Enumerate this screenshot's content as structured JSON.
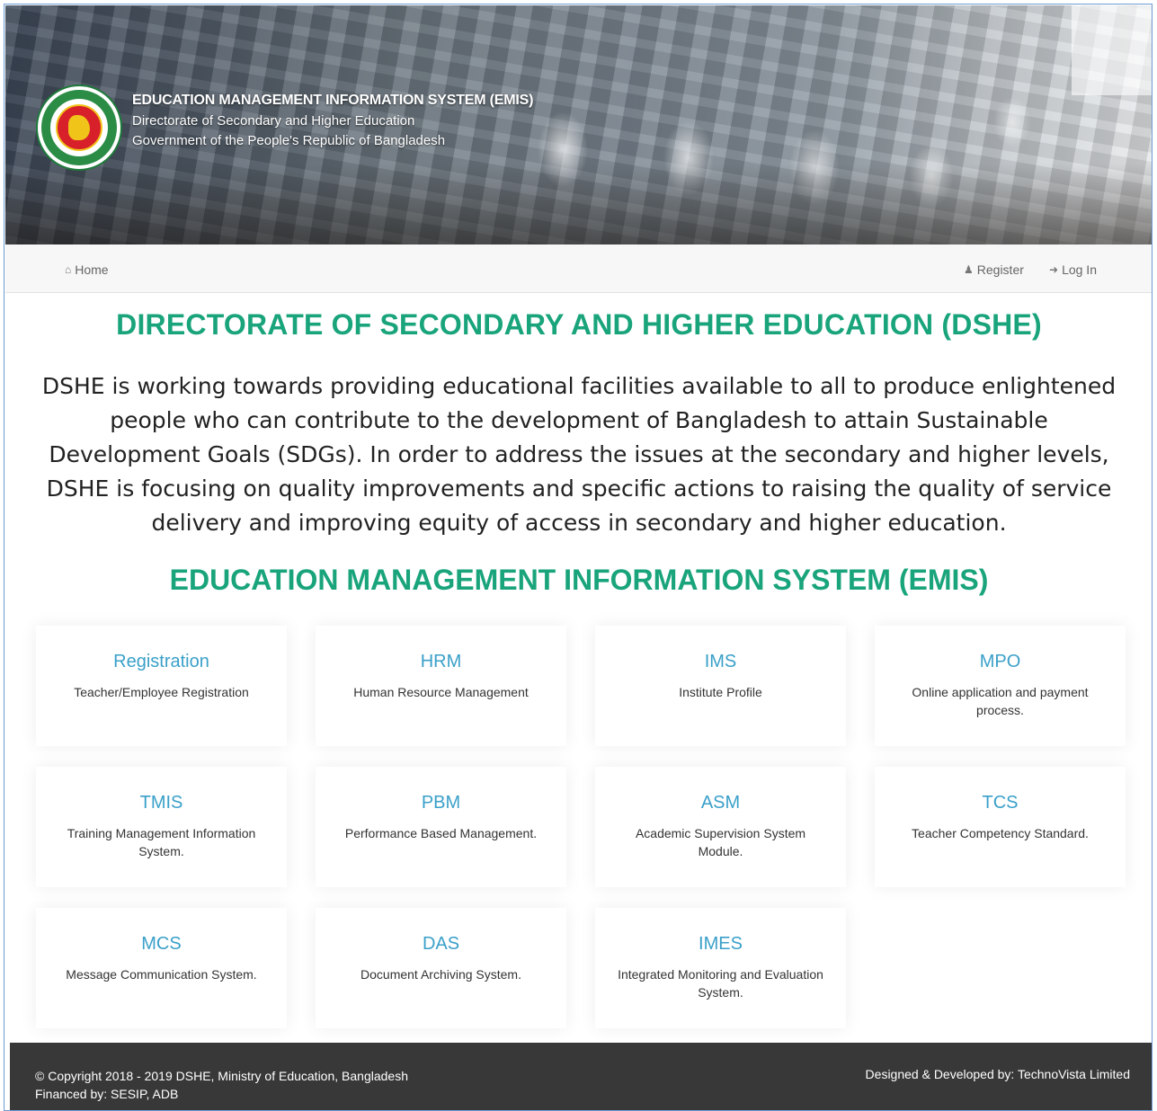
{
  "header": {
    "title": "EDUCATION MANAGEMENT INFORMATION SYSTEM (EMIS)",
    "subtitle1": "Directorate of Secondary and Higher Education",
    "subtitle2": "Government of the People's Republic of Bangladesh"
  },
  "nav": {
    "home": "Home",
    "register": "Register",
    "login": "Log In",
    "icons": {
      "home": "home-icon",
      "register": "user-icon",
      "login": "sign-in-icon"
    }
  },
  "main": {
    "heading": "DIRECTORATE OF SECONDARY AND HIGHER EDUCATION (DSHE)",
    "description": "DSHE is working towards providing educational facilities available to all to produce enlightened people who can contribute to the development of Bangladesh to attain Sustainable Development Goals (SDGs). In order to address the issues at the secondary and higher levels, DSHE is focusing on quality improvements and specific actions to raising the quality of service delivery and improving equity of access in secondary and higher education.",
    "emis_heading": "EDUCATION MANAGEMENT INFORMATION SYSTEM (EMIS)",
    "modules": [
      {
        "title": "Registration",
        "desc": "Teacher/Employee Registration"
      },
      {
        "title": "HRM",
        "desc": "Human Resource Management"
      },
      {
        "title": "IMS",
        "desc": "Institute Profile"
      },
      {
        "title": "MPO",
        "desc": "Online application and payment process."
      },
      {
        "title": "TMIS",
        "desc": "Training Management Information System."
      },
      {
        "title": "PBM",
        "desc": "Performance Based Management."
      },
      {
        "title": "ASM",
        "desc": "Academic Supervision System Module."
      },
      {
        "title": "TCS",
        "desc": "Teacher Competency Standard."
      },
      {
        "title": "MCS",
        "desc": "Message Communication System."
      },
      {
        "title": "DAS",
        "desc": "Document Archiving System."
      },
      {
        "title": "IMES",
        "desc": "Integrated Monitoring and Evaluation System."
      }
    ]
  },
  "footer": {
    "copyright": "© Copyright 2018 - 2019 DSHE, Ministry of Education, Bangladesh",
    "financed": "Financed by: SESIP, ADB",
    "developer": "Designed & Developed by: TechnoVista Limited"
  },
  "colors": {
    "heading": "#19a47b",
    "module_title": "#3aa0c9",
    "footer_bg": "#383838"
  }
}
